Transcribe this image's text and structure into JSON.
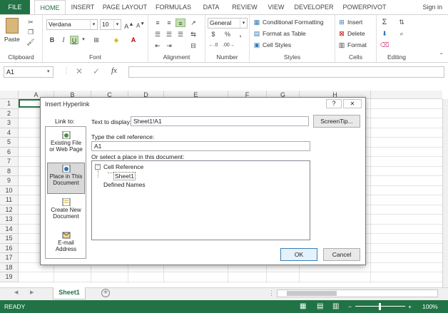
{
  "tabs": [
    "FILE",
    "HOME",
    "INSERT",
    "PAGE LAYOUT",
    "FORMULAS",
    "DATA",
    "REVIEW",
    "VIEW",
    "DEVELOPER",
    "POWERPIVOT"
  ],
  "signin": "Sign in",
  "ribbon": {
    "clipboard": {
      "label": "Clipboard",
      "paste": "Paste"
    },
    "font": {
      "label": "Font",
      "name": "Verdana",
      "size": "10",
      "bold": "B",
      "italic": "I",
      "underline": "U"
    },
    "alignment": {
      "label": "Alignment"
    },
    "number": {
      "label": "Number",
      "format": "General",
      "currency": "$",
      "percent": "%",
      "comma": ","
    },
    "styles": {
      "label": "Styles",
      "conditional": "Conditional Formatting",
      "table": "Format as Table",
      "cell": "Cell Styles"
    },
    "cells": {
      "label": "Cells",
      "insert": "Insert",
      "delete": "Delete",
      "format": "Format"
    },
    "editing": {
      "label": "Editing"
    }
  },
  "formula_bar": {
    "name_box": "A1",
    "fx": "fx"
  },
  "columns": [
    "A",
    "B",
    "C",
    "D",
    "E",
    "F",
    "G",
    "H"
  ],
  "rows": [
    "1",
    "2",
    "3",
    "4",
    "5",
    "6",
    "7",
    "8",
    "9",
    "10",
    "11",
    "12",
    "13",
    "14",
    "15",
    "16",
    "17",
    "18",
    "19"
  ],
  "sheet_tab": "Sheet1",
  "status": {
    "ready": "READY",
    "zoom": "100%"
  },
  "dialog": {
    "title": "Insert Hyperlink",
    "help": "?",
    "close": "✕",
    "link_to": "Link to:",
    "link_items": [
      {
        "label1": "Existing File",
        "label2": "or Web Page"
      },
      {
        "label1": "Place in This",
        "label2": "Document"
      },
      {
        "label1": "Create New",
        "label2": "Document"
      },
      {
        "label1": "E-mail",
        "label2": "Address"
      }
    ],
    "text_to_display_label": "Text to display:",
    "text_to_display_value": "Sheet1!A1",
    "screentip": "ScreenTip...",
    "cell_ref_label": "Type the cell reference:",
    "cell_ref_value": "A1",
    "place_label": "Or select a place in this document:",
    "tree": {
      "root": "Cell Reference",
      "child": "Sheet1",
      "other": "Defined Names"
    },
    "ok": "OK",
    "cancel": "Cancel"
  }
}
